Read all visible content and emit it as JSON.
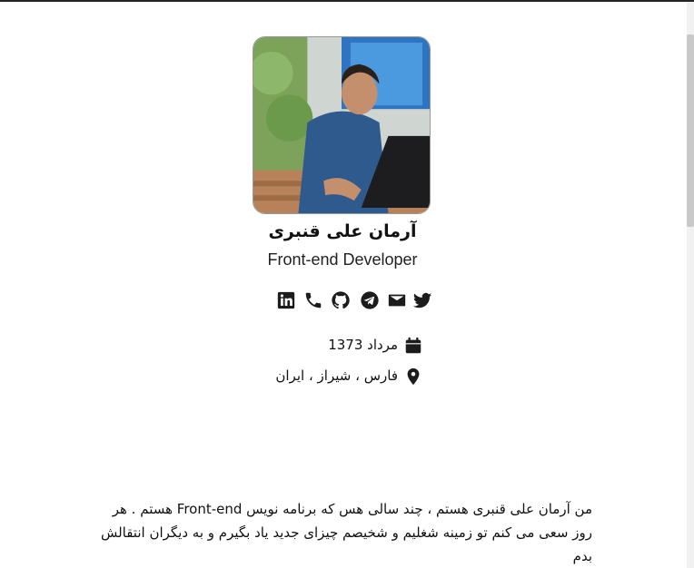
{
  "profile": {
    "name": "آرمان علی قنبری",
    "role": "Front-end Developer"
  },
  "socials": [
    {
      "icon": "twitter-icon"
    },
    {
      "icon": "email-icon"
    },
    {
      "icon": "telegram-icon"
    },
    {
      "icon": "github-icon"
    },
    {
      "icon": "phone-icon"
    },
    {
      "icon": "linkedin-icon"
    }
  ],
  "info": {
    "birth": "مرداد 1373",
    "location": "فارس ، شیراز ، ایران"
  },
  "bio": {
    "text": "من آرمان علی قنبری هستم ، چند سالی هس که برنامه نویس Front-end هستم . هر روز سعی می کنم تو زمینه شغلیم و شخیصم چیزای جدید یاد بگیرم و به دیگران انتقالش بدم"
  },
  "colors": {
    "text": "#111111",
    "icon": "#1c1c1c"
  }
}
